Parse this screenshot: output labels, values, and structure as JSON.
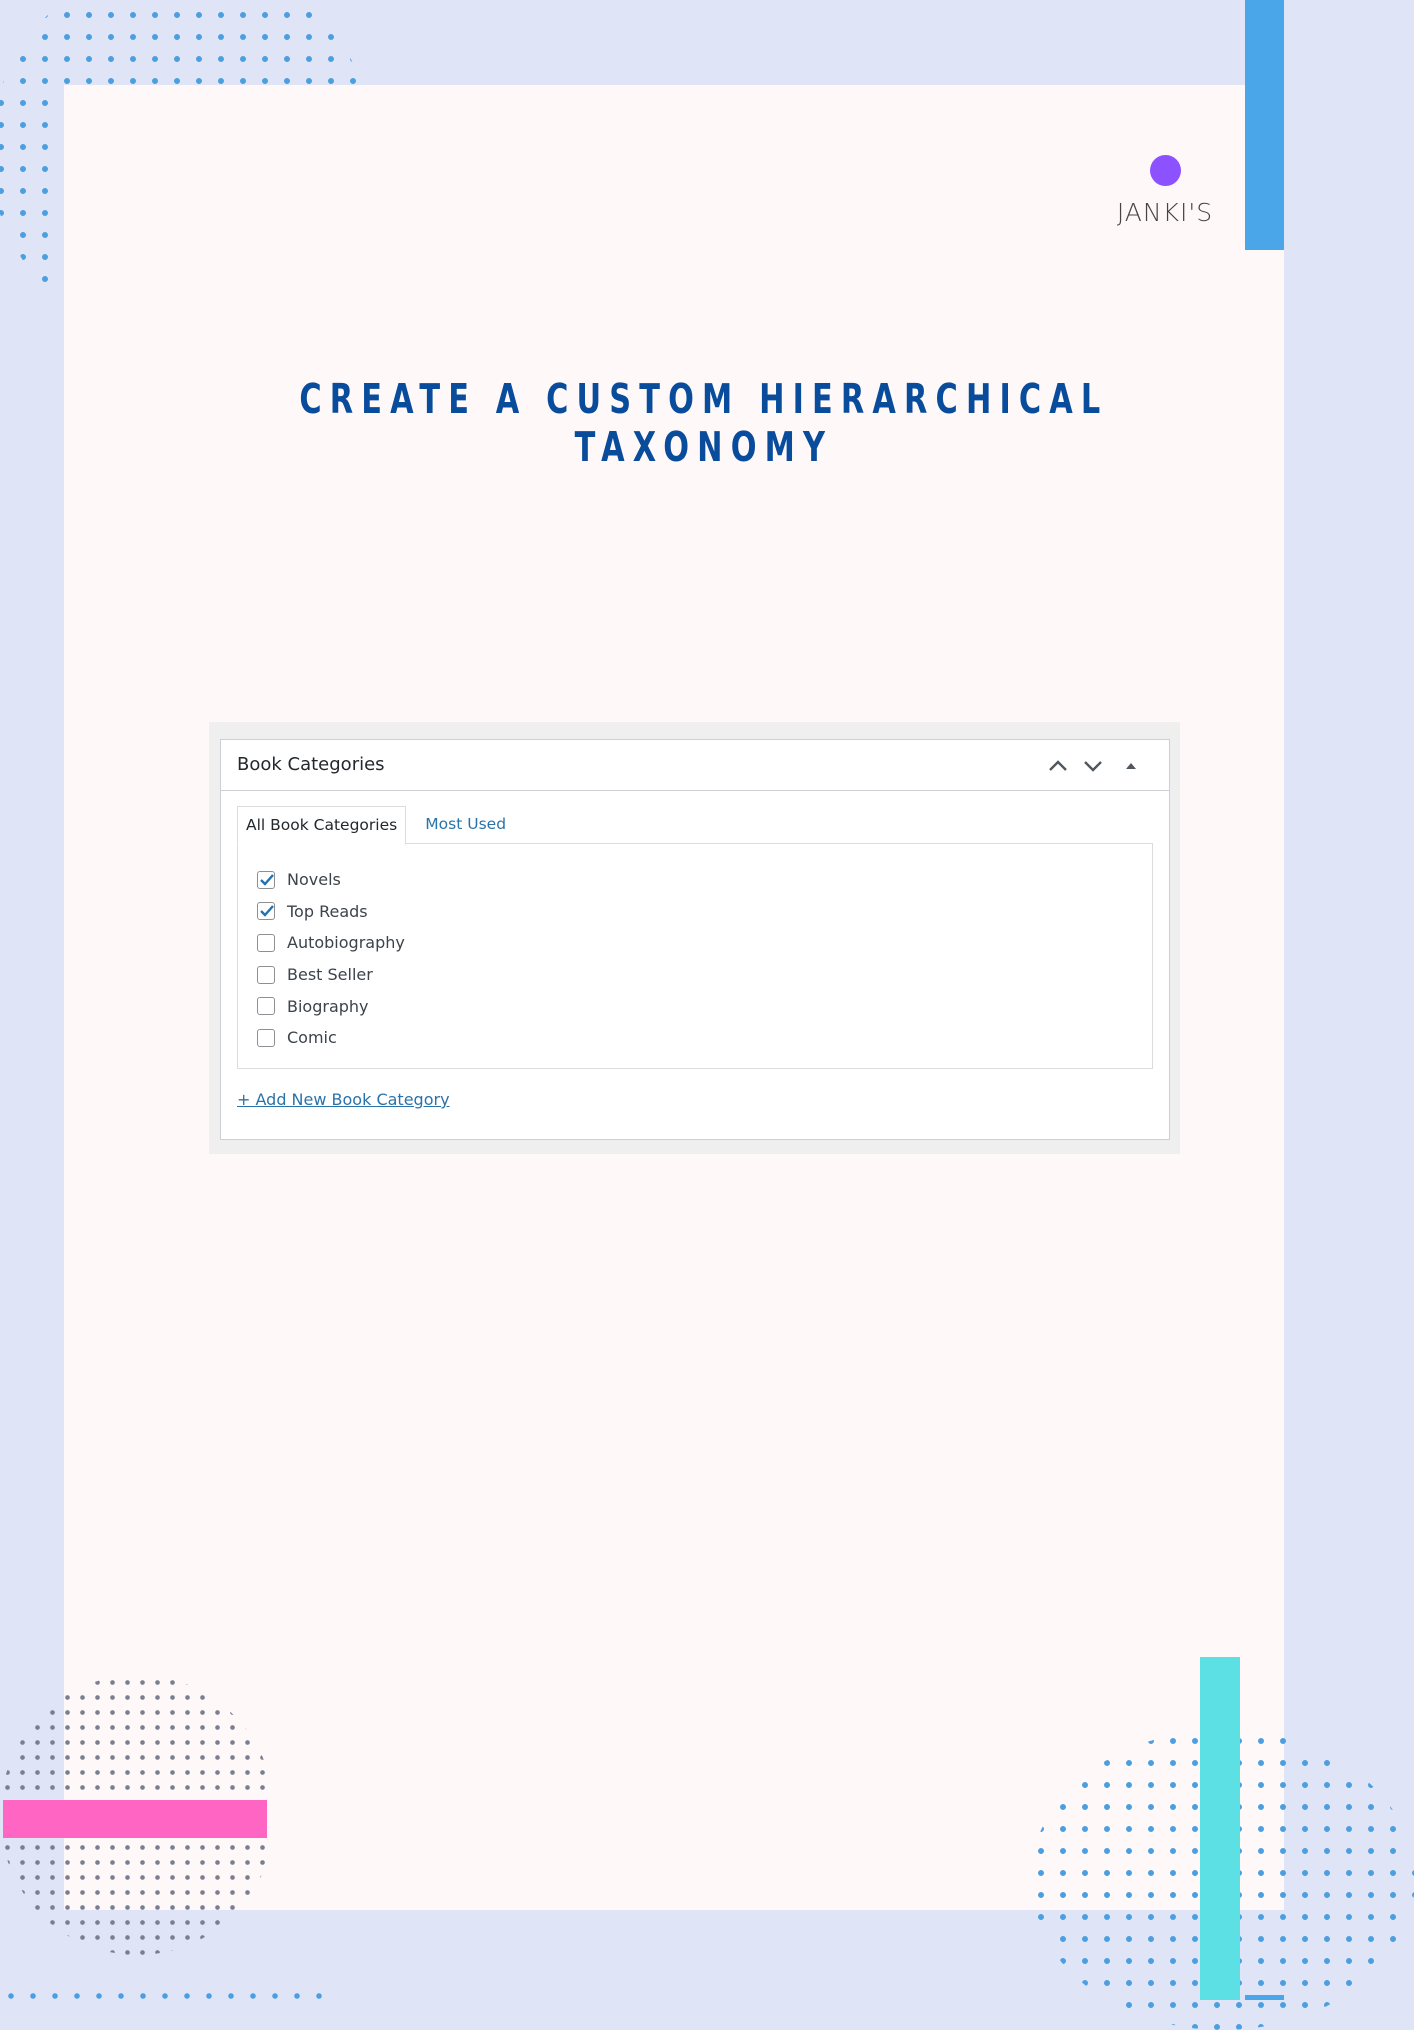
{
  "colors": {
    "background": "#dfe4f6",
    "page": "#fef8f8",
    "title": "#0a4c9c",
    "accent_blue": "#4aa6e8",
    "accent_cyan": "#5ce0e4",
    "accent_pink": "#ff66c4",
    "logo_dot": "#8c52ff",
    "link": "#2a73aa"
  },
  "brand": {
    "logo_text": "JANKI'S"
  },
  "title": "CREATE A CUSTOM HIERARCHICAL TAXONOMY",
  "metabox": {
    "title": "Book Categories",
    "controls": [
      "chevron-up-icon",
      "chevron-down-icon",
      "triangle-up-icon"
    ],
    "tabs": [
      {
        "label": "All Book Categories",
        "active": true
      },
      {
        "label": "Most Used",
        "active": false
      }
    ],
    "categories": [
      {
        "label": "Novels",
        "checked": true
      },
      {
        "label": "Top Reads",
        "checked": true
      },
      {
        "label": "Autobiography",
        "checked": false
      },
      {
        "label": "Best Seller",
        "checked": false
      },
      {
        "label": "Biography",
        "checked": false
      },
      {
        "label": "Comic",
        "checked": false
      }
    ],
    "add_new_label": "+ Add New Book Category"
  }
}
